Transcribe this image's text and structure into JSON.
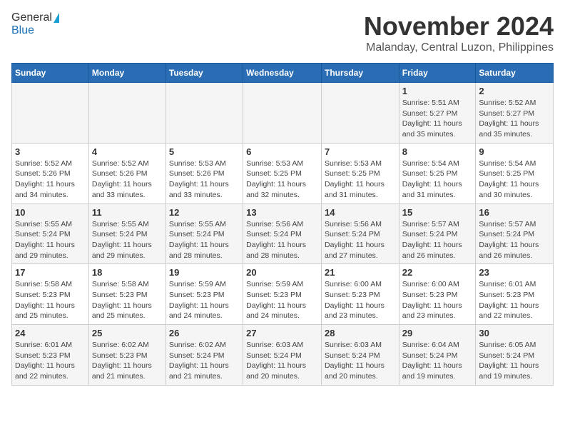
{
  "logo": {
    "general": "General",
    "blue": "Blue"
  },
  "title": "November 2024",
  "location": "Malanday, Central Luzon, Philippines",
  "weekdays": [
    "Sunday",
    "Monday",
    "Tuesday",
    "Wednesday",
    "Thursday",
    "Friday",
    "Saturday"
  ],
  "weeks": [
    [
      {
        "day": "",
        "info": ""
      },
      {
        "day": "",
        "info": ""
      },
      {
        "day": "",
        "info": ""
      },
      {
        "day": "",
        "info": ""
      },
      {
        "day": "",
        "info": ""
      },
      {
        "day": "1",
        "info": "Sunrise: 5:51 AM\nSunset: 5:27 PM\nDaylight: 11 hours\nand 35 minutes."
      },
      {
        "day": "2",
        "info": "Sunrise: 5:52 AM\nSunset: 5:27 PM\nDaylight: 11 hours\nand 35 minutes."
      }
    ],
    [
      {
        "day": "3",
        "info": "Sunrise: 5:52 AM\nSunset: 5:26 PM\nDaylight: 11 hours\nand 34 minutes."
      },
      {
        "day": "4",
        "info": "Sunrise: 5:52 AM\nSunset: 5:26 PM\nDaylight: 11 hours\nand 33 minutes."
      },
      {
        "day": "5",
        "info": "Sunrise: 5:53 AM\nSunset: 5:26 PM\nDaylight: 11 hours\nand 33 minutes."
      },
      {
        "day": "6",
        "info": "Sunrise: 5:53 AM\nSunset: 5:25 PM\nDaylight: 11 hours\nand 32 minutes."
      },
      {
        "day": "7",
        "info": "Sunrise: 5:53 AM\nSunset: 5:25 PM\nDaylight: 11 hours\nand 31 minutes."
      },
      {
        "day": "8",
        "info": "Sunrise: 5:54 AM\nSunset: 5:25 PM\nDaylight: 11 hours\nand 31 minutes."
      },
      {
        "day": "9",
        "info": "Sunrise: 5:54 AM\nSunset: 5:25 PM\nDaylight: 11 hours\nand 30 minutes."
      }
    ],
    [
      {
        "day": "10",
        "info": "Sunrise: 5:55 AM\nSunset: 5:24 PM\nDaylight: 11 hours\nand 29 minutes."
      },
      {
        "day": "11",
        "info": "Sunrise: 5:55 AM\nSunset: 5:24 PM\nDaylight: 11 hours\nand 29 minutes."
      },
      {
        "day": "12",
        "info": "Sunrise: 5:55 AM\nSunset: 5:24 PM\nDaylight: 11 hours\nand 28 minutes."
      },
      {
        "day": "13",
        "info": "Sunrise: 5:56 AM\nSunset: 5:24 PM\nDaylight: 11 hours\nand 28 minutes."
      },
      {
        "day": "14",
        "info": "Sunrise: 5:56 AM\nSunset: 5:24 PM\nDaylight: 11 hours\nand 27 minutes."
      },
      {
        "day": "15",
        "info": "Sunrise: 5:57 AM\nSunset: 5:24 PM\nDaylight: 11 hours\nand 26 minutes."
      },
      {
        "day": "16",
        "info": "Sunrise: 5:57 AM\nSunset: 5:24 PM\nDaylight: 11 hours\nand 26 minutes."
      }
    ],
    [
      {
        "day": "17",
        "info": "Sunrise: 5:58 AM\nSunset: 5:23 PM\nDaylight: 11 hours\nand 25 minutes."
      },
      {
        "day": "18",
        "info": "Sunrise: 5:58 AM\nSunset: 5:23 PM\nDaylight: 11 hours\nand 25 minutes."
      },
      {
        "day": "19",
        "info": "Sunrise: 5:59 AM\nSunset: 5:23 PM\nDaylight: 11 hours\nand 24 minutes."
      },
      {
        "day": "20",
        "info": "Sunrise: 5:59 AM\nSunset: 5:23 PM\nDaylight: 11 hours\nand 24 minutes."
      },
      {
        "day": "21",
        "info": "Sunrise: 6:00 AM\nSunset: 5:23 PM\nDaylight: 11 hours\nand 23 minutes."
      },
      {
        "day": "22",
        "info": "Sunrise: 6:00 AM\nSunset: 5:23 PM\nDaylight: 11 hours\nand 23 minutes."
      },
      {
        "day": "23",
        "info": "Sunrise: 6:01 AM\nSunset: 5:23 PM\nDaylight: 11 hours\nand 22 minutes."
      }
    ],
    [
      {
        "day": "24",
        "info": "Sunrise: 6:01 AM\nSunset: 5:23 PM\nDaylight: 11 hours\nand 22 minutes."
      },
      {
        "day": "25",
        "info": "Sunrise: 6:02 AM\nSunset: 5:23 PM\nDaylight: 11 hours\nand 21 minutes."
      },
      {
        "day": "26",
        "info": "Sunrise: 6:02 AM\nSunset: 5:24 PM\nDaylight: 11 hours\nand 21 minutes."
      },
      {
        "day": "27",
        "info": "Sunrise: 6:03 AM\nSunset: 5:24 PM\nDaylight: 11 hours\nand 20 minutes."
      },
      {
        "day": "28",
        "info": "Sunrise: 6:03 AM\nSunset: 5:24 PM\nDaylight: 11 hours\nand 20 minutes."
      },
      {
        "day": "29",
        "info": "Sunrise: 6:04 AM\nSunset: 5:24 PM\nDaylight: 11 hours\nand 19 minutes."
      },
      {
        "day": "30",
        "info": "Sunrise: 6:05 AM\nSunset: 5:24 PM\nDaylight: 11 hours\nand 19 minutes."
      }
    ]
  ]
}
